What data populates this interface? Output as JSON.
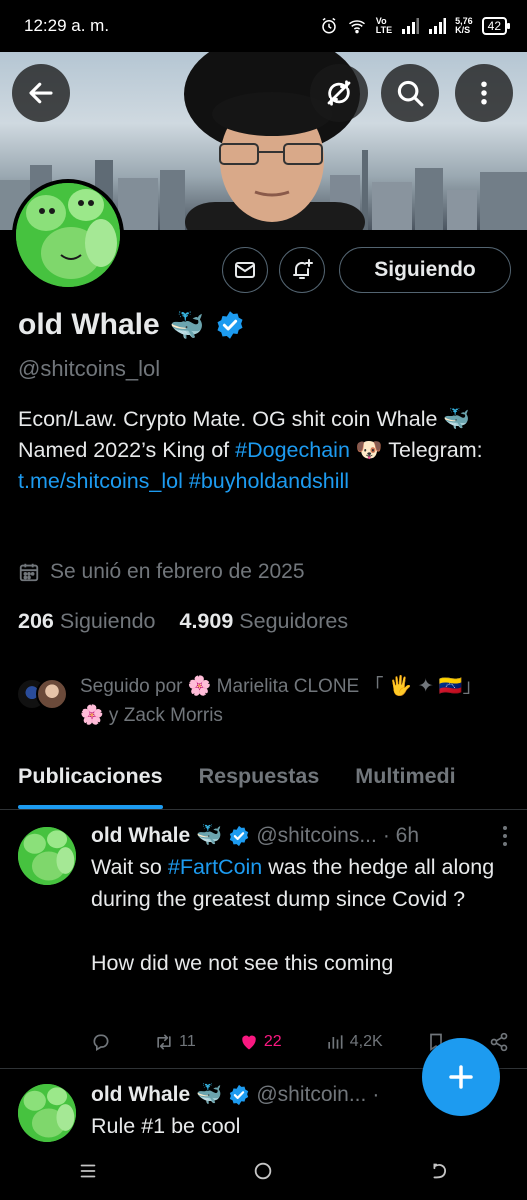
{
  "statusbar": {
    "time": "12:29 a. m.",
    "network": "5,76\nK/S",
    "battery": "42",
    "lte": "Vo\nLTE"
  },
  "profile": {
    "name": "old Whale",
    "name_emoji": "🐳",
    "handle": "@shitcoins_lol",
    "bio_prefix": "Econ/Law. Crypto Mate. OG shit coin Whale 🐳 Named 2022’s King of ",
    "bio_link1": "#Dogechain",
    "bio_mid": " 🐶 Telegram: ",
    "bio_link2": "t.me/​shitcoins_lol",
    "bio_space": " ",
    "bio_link3": "#buyholdandshill",
    "joined": "Se unió en febrero de 2025",
    "following_count": "206",
    "following_label": "Siguiendo",
    "followers_count": "4.909",
    "followers_label": "Seguidores",
    "followed_by": "Seguido por 🌸 Marielita CLONE 「 🖐 ✦ 🇻🇪」 🌸 y Zack Morris",
    "follow_button": "Siguiendo"
  },
  "tabs": [
    {
      "label": "Publicaciones",
      "active": true
    },
    {
      "label": "Respuestas",
      "active": false
    },
    {
      "label": "Multimedi",
      "active": false
    }
  ],
  "tweets": [
    {
      "name": "old Whale",
      "emoji": "🐳",
      "handle": "@shitcoins...",
      "time": "· 6h",
      "text_pre": "Wait so ",
      "text_link": "#FartCoin",
      "text_post": " was the hedge all along during the greatest dump since Covid ?",
      "text_2": "How did we not see this coming",
      "retweets": "11",
      "likes": "22",
      "views": "4,2K"
    },
    {
      "name": "old Whale",
      "emoji": "🐳",
      "handle": "@shitcoin...",
      "time": "·",
      "text": "Rule #1 be cool"
    }
  ],
  "colors": {
    "accent": "#1d9bf0",
    "like": "#f91880",
    "muted": "#71767b",
    "background": "#000000"
  },
  "icons": [
    "back-arrow-icon",
    "no-sync-icon",
    "search-icon",
    "more-vert-icon",
    "mail-icon",
    "bell-plus-icon",
    "calendar-icon",
    "verified-icon",
    "reply-icon",
    "retweet-icon",
    "heart-icon",
    "views-icon",
    "bookmark-icon",
    "share-icon",
    "plus-icon"
  ]
}
